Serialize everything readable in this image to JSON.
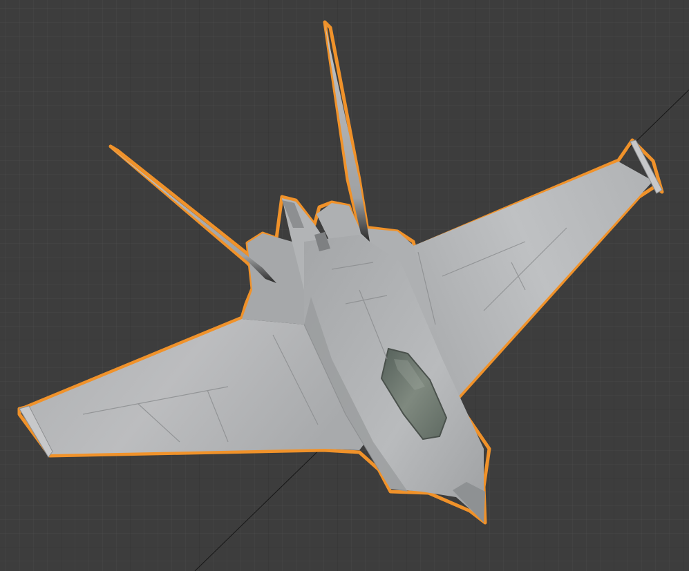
{
  "app": {
    "window": "3D Viewport"
  },
  "viewport": {
    "background": "#3d3d3d",
    "grid": true,
    "selection_outline_color": "#f0922a",
    "mesh_color": "#b4b6b8",
    "canopy_color": "#6f7a70"
  },
  "object": {
    "type": "jet fighter model",
    "selected": true
  }
}
